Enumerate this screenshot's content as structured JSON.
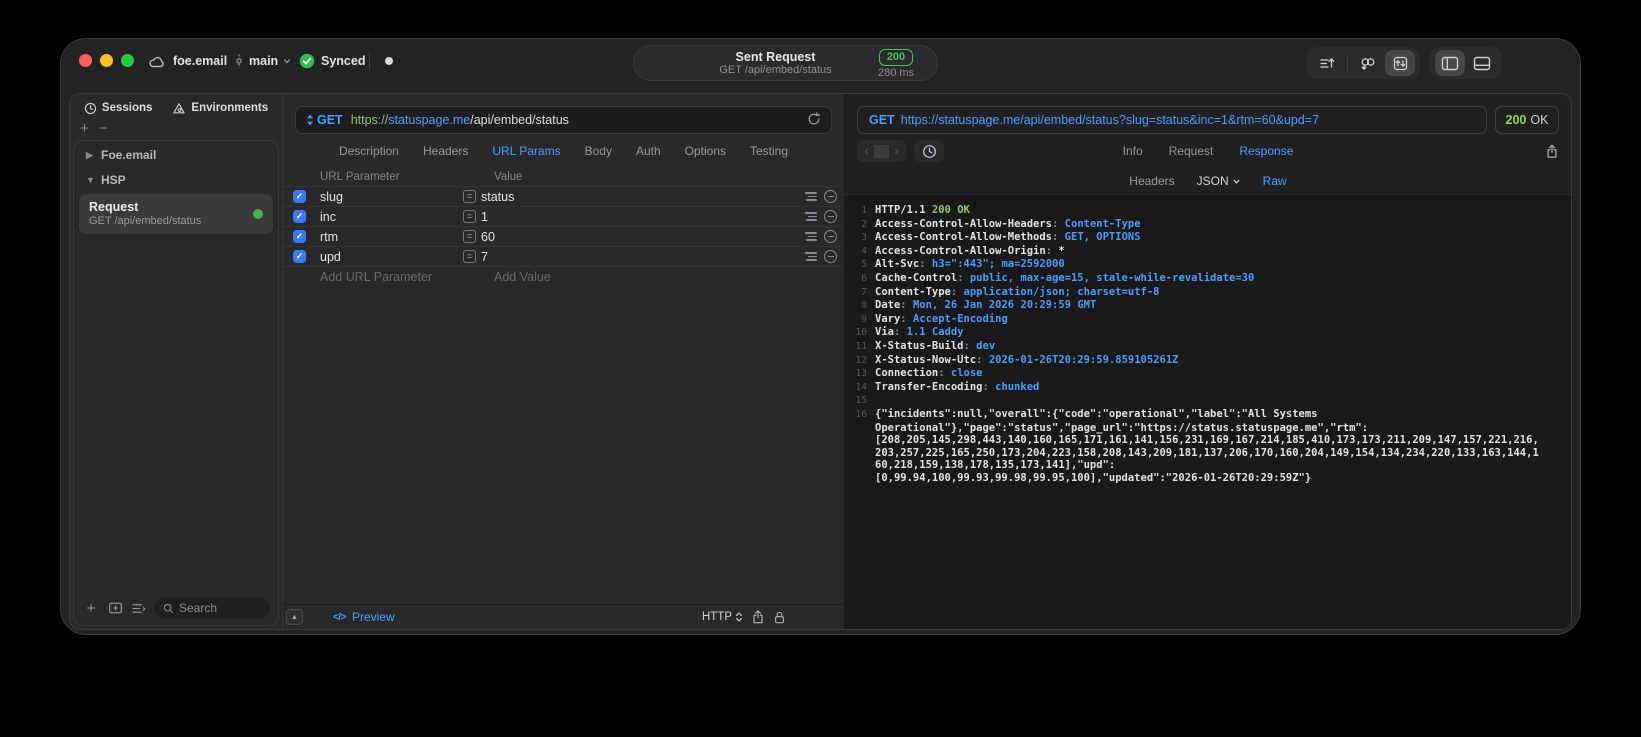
{
  "titlebar": {
    "project": "foe.email",
    "branch": "main",
    "sync_status": "Synced",
    "request_pill": {
      "title": "Sent Request",
      "subtitle": "GET /api/embed/status",
      "status_code": "200",
      "duration": "280 ms"
    }
  },
  "sidebar": {
    "tabs": [
      {
        "label": "Sessions"
      },
      {
        "label": "Environments"
      }
    ],
    "add_label": "+",
    "remove_label": "−",
    "groups": [
      {
        "label": "Foe.email",
        "expanded": false
      },
      {
        "label": "HSP",
        "expanded": true
      }
    ],
    "selected_request": {
      "name": "Request",
      "method_path": "GET /api/embed/status"
    },
    "search_placeholder": "Search"
  },
  "editor": {
    "method": "GET",
    "url": {
      "scheme": "https://",
      "host": "statuspage.me",
      "path": "/api/embed/status"
    },
    "tabs": [
      "Description",
      "Headers",
      "URL Params",
      "Body",
      "Auth",
      "Options",
      "Testing"
    ],
    "active_tab": "URL Params",
    "table": {
      "columns": [
        "URL Parameter",
        "Value"
      ],
      "rows": [
        {
          "name": "slug",
          "value": "status",
          "checked": true
        },
        {
          "name": "inc",
          "value": "1",
          "checked": true
        },
        {
          "name": "rtm",
          "value": "60",
          "checked": true
        },
        {
          "name": "upd",
          "value": "7",
          "checked": true
        }
      ],
      "add_name_placeholder": "Add URL Parameter",
      "add_value_placeholder": "Add Value"
    },
    "footer": {
      "preview_label": "Preview",
      "code_glyph": "</>",
      "protocol": "HTTP"
    }
  },
  "viewer": {
    "request_method": "GET",
    "request_url": "https://statuspage.me/api/embed/status?slug=status&inc=1&rtm=60&upd=7",
    "status": {
      "code": "200",
      "text": "OK"
    },
    "tabs": [
      "Info",
      "Request",
      "Response"
    ],
    "active_tab": "Response",
    "subtabs": [
      {
        "label": "Headers"
      },
      {
        "label": "JSON",
        "dropdown": true
      },
      {
        "label": "Raw",
        "active": true
      }
    ],
    "code_lines": [
      {
        "num": "1",
        "segs": [
          {
            "t": "HTTP/1.1 ",
            "c": "w"
          },
          {
            "t": "200 OK",
            "c": "g"
          }
        ]
      },
      {
        "num": "2",
        "segs": [
          {
            "t": "Access-Control-Allow-Headers",
            "c": "w"
          },
          {
            "t": ": ",
            "c": "p"
          },
          {
            "t": "Content-Type",
            "c": "b"
          }
        ]
      },
      {
        "num": "3",
        "segs": [
          {
            "t": "Access-Control-Allow-Methods",
            "c": "w"
          },
          {
            "t": ": ",
            "c": "p"
          },
          {
            "t": "GET, OPTIONS",
            "c": "b"
          }
        ]
      },
      {
        "num": "4",
        "segs": [
          {
            "t": "Access-Control-Allow-Origin",
            "c": "w"
          },
          {
            "t": ": ",
            "c": "p"
          },
          {
            "t": "*",
            "c": "w"
          }
        ]
      },
      {
        "num": "5",
        "segs": [
          {
            "t": "Alt-Svc",
            "c": "w"
          },
          {
            "t": ": ",
            "c": "p"
          },
          {
            "t": "h3=\":443\"; ma=2592000",
            "c": "b"
          }
        ]
      },
      {
        "num": "6",
        "segs": [
          {
            "t": "Cache-Control",
            "c": "w"
          },
          {
            "t": ": ",
            "c": "p"
          },
          {
            "t": "public, max-age=15, stale-while-revalidate=30",
            "c": "b"
          }
        ]
      },
      {
        "num": "7",
        "segs": [
          {
            "t": "Content-Type",
            "c": "w"
          },
          {
            "t": ": ",
            "c": "p"
          },
          {
            "t": "application/json; charset=utf-8",
            "c": "b"
          }
        ]
      },
      {
        "num": "8",
        "segs": [
          {
            "t": "Date",
            "c": "w"
          },
          {
            "t": ": ",
            "c": "p"
          },
          {
            "t": "Mon, 26 Jan 2026 20:29:59 GMT",
            "c": "b"
          }
        ]
      },
      {
        "num": "9",
        "segs": [
          {
            "t": "Vary",
            "c": "w"
          },
          {
            "t": ": ",
            "c": "p"
          },
          {
            "t": "Accept-Encoding",
            "c": "b"
          }
        ]
      },
      {
        "num": "10",
        "segs": [
          {
            "t": "Via",
            "c": "w"
          },
          {
            "t": ": ",
            "c": "p"
          },
          {
            "t": "1.1 Caddy",
            "c": "b"
          }
        ]
      },
      {
        "num": "11",
        "segs": [
          {
            "t": "X-Status-Build",
            "c": "w"
          },
          {
            "t": ": ",
            "c": "p"
          },
          {
            "t": "dev",
            "c": "b"
          }
        ]
      },
      {
        "num": "12",
        "segs": [
          {
            "t": "X-Status-Now-Utc",
            "c": "w"
          },
          {
            "t": ": ",
            "c": "p"
          },
          {
            "t": "2026-01-26T20:29:59.859105261Z",
            "c": "b"
          }
        ]
      },
      {
        "num": "13",
        "segs": [
          {
            "t": "Connection",
            "c": "w"
          },
          {
            "t": ": ",
            "c": "p"
          },
          {
            "t": "close",
            "c": "b"
          }
        ]
      },
      {
        "num": "14",
        "segs": [
          {
            "t": "Transfer-Encoding",
            "c": "w"
          },
          {
            "t": ": ",
            "c": "p"
          },
          {
            "t": "chunked",
            "c": "b"
          }
        ]
      },
      {
        "num": "15",
        "segs": []
      },
      {
        "num": "16",
        "segs": [
          {
            "t": "{\"incidents\":null,\"overall\":{\"code\":\"operational\",\"label\":\"All Systems",
            "c": "w"
          }
        ]
      },
      {
        "num": "",
        "segs": [
          {
            "t": "Operational\"},\"page\":\"status\",\"page_url\":\"https://status.statuspage.me\",\"rtm\":",
            "c": "w"
          }
        ]
      },
      {
        "num": "",
        "segs": [
          {
            "t": "[208,205,145,298,443,140,160,165,171,161,141,156,231,169,167,214,185,410,173,173,211,209,147,157,221,216,",
            "c": "w"
          }
        ]
      },
      {
        "num": "",
        "segs": [
          {
            "t": "203,257,225,165,250,173,204,223,158,208,143,209,181,137,206,170,160,204,149,154,134,234,220,133,163,144,1",
            "c": "w"
          }
        ]
      },
      {
        "num": "",
        "segs": [
          {
            "t": "60,218,159,138,178,135,173,141],\"upd\":",
            "c": "w"
          }
        ]
      },
      {
        "num": "",
        "segs": [
          {
            "t": "[0,99.94,100,99.93,99.98,99.95,100],\"updated\":\"2026-01-26T20:29:59Z\"}",
            "c": "w"
          }
        ]
      }
    ]
  },
  "colors": {
    "accent_blue": "#4b9eff",
    "badge_green": "#47c258",
    "code_green": "#93c75c",
    "code_blue": "#4f9cf8",
    "traffic_red": "#ff5f57",
    "traffic_yellow": "#febc2e",
    "traffic_green": "#28c840"
  }
}
